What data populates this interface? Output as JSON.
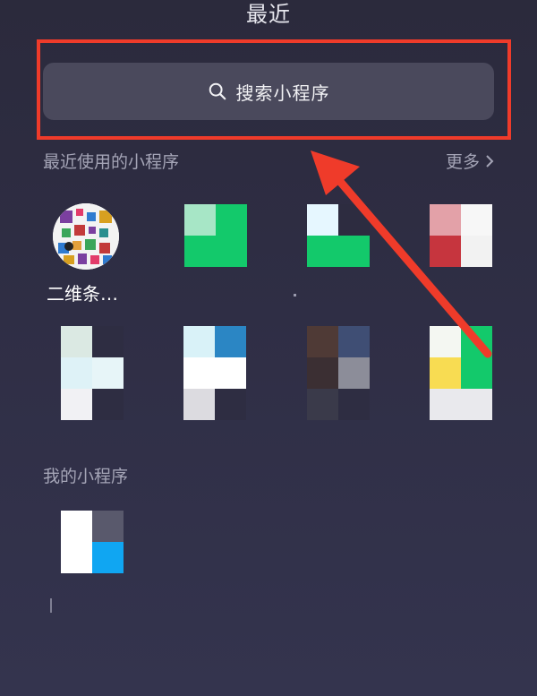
{
  "header": {
    "title": "最近"
  },
  "search": {
    "label": "搜索小程序",
    "icon": "search-icon"
  },
  "recent_section": {
    "label": "最近使用的小程序",
    "more_label": "更多",
    "more_icon": "chevron-right-icon",
    "first_app_name": "二维条…"
  },
  "my_section": {
    "label": "我的小程序"
  },
  "colors": {
    "highlight": "#ef3b2a",
    "arrow": "#ef3b2a",
    "search_bg": "#4a495c",
    "label": "#a4a4b6"
  }
}
